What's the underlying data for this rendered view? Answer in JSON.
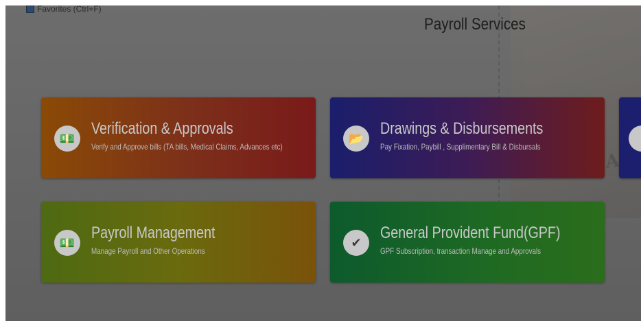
{
  "header": {
    "favorites_label": "Favorites (Ctrl+F)",
    "page_title": "Payroll Services"
  },
  "background": {
    "stamp_text": "INDIA"
  },
  "cards": [
    {
      "id": "verification",
      "title": "Verification & Approvals",
      "subtitle": "Verify and Approve bills (TA bills, Medical Claims, Advances etc)",
      "icon": "money-growth-icon",
      "icon_glyph": "💵"
    },
    {
      "id": "drawings",
      "title": "Drawings & Disbursements",
      "subtitle": "Pay Fixation, Paybill , Supplimentary Bill & Disbursals",
      "icon": "folder-open-icon",
      "icon_glyph": "📂"
    },
    {
      "id": "payroll",
      "title": "Payroll Management",
      "subtitle": "Manage Payroll and Other Operations",
      "icon": "money-growth-icon",
      "icon_glyph": "💵"
    },
    {
      "id": "gpf",
      "title": "General Provident Fund(GPF)",
      "subtitle": "GPF Subscription, transaction Manage and Approvals",
      "icon": "double-check-icon",
      "icon_glyph": "✔"
    }
  ],
  "colors": {
    "verification": "#8a4a06",
    "drawings": "#1a1e6c",
    "payroll": "#4d6a12",
    "gpf": "#0d5a2d",
    "overlay": "#666666"
  }
}
